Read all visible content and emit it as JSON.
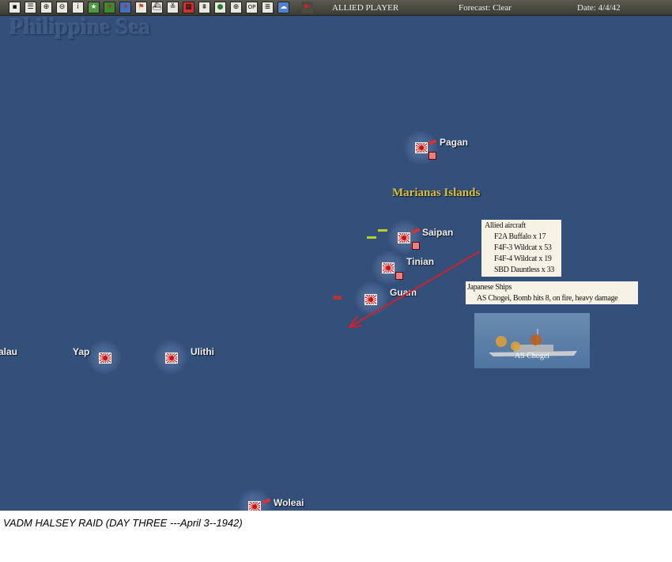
{
  "toolbar": {
    "icons": [
      "save-icon",
      "list-icon",
      "air-group-icon",
      "ship-group-icon",
      "info-icon",
      "victory-star-icon",
      "fighter-icon",
      "bomber-icon",
      "flag-icon",
      "ship-icon",
      "convoy-icon",
      "territory-icon",
      "land-unit-icon",
      "globe-icon",
      "target-icon",
      "operations-icon",
      "log-icon",
      "weather-icon",
      "end-turn-icon"
    ],
    "op_label": "OP",
    "player": "ALLIED PLAYER",
    "forecast": "Forecast: Clear",
    "date": "Date: 4/4/42"
  },
  "map": {
    "sea_name": "Philippine Sea",
    "region_name": "Marianas Islands",
    "islands": [
      {
        "name": "Pagan",
        "airbase": true
      },
      {
        "name": "Saipan",
        "airbase": true
      },
      {
        "name": "Tinian"
      },
      {
        "name": "Guam"
      },
      {
        "name": "Yap"
      },
      {
        "name": "Ulithi"
      },
      {
        "name": "Woleai",
        "airbase": true
      },
      {
        "name": "alau"
      }
    ],
    "colors": {
      "sea": "#33507a",
      "region_label": "#d8c040",
      "strike_arrow": "#d0202a"
    }
  },
  "combat": {
    "aircraft_title": "Allied aircraft",
    "aircraft": [
      "F2A Buffalo x 17",
      "F4F-3 Wildcat x 53",
      "F4F-4 Wildcat x 19",
      "SBD Dauntless x 33"
    ],
    "ships_title": "Japanese Ships",
    "ships": [
      "AS Chogei, Bomb hits 8,  on fire,  heavy damage"
    ],
    "ship_image_label": "AS Chogei"
  },
  "caption": "VADM HALSEY RAID (DAY THREE ---April 3--1942)"
}
